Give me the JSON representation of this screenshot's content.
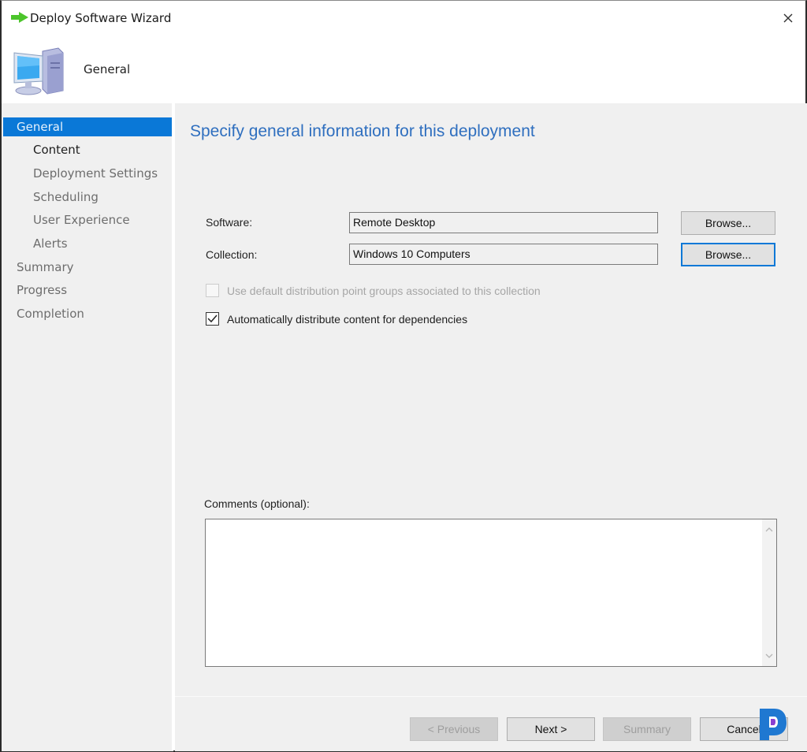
{
  "window": {
    "title": "Deploy Software Wizard",
    "close_icon": "close-icon",
    "title_icon": "green-arrow-icon"
  },
  "header": {
    "title": "General",
    "icon": "computer-icon"
  },
  "sidebar": {
    "items": [
      {
        "label": "General",
        "level": "top",
        "state": "active"
      },
      {
        "label": "Content",
        "level": "sub",
        "state": "current"
      },
      {
        "label": "Deployment Settings",
        "level": "sub",
        "state": "pending"
      },
      {
        "label": "Scheduling",
        "level": "sub",
        "state": "pending"
      },
      {
        "label": "User Experience",
        "level": "sub",
        "state": "pending"
      },
      {
        "label": "Alerts",
        "level": "sub",
        "state": "pending"
      },
      {
        "label": "Summary",
        "level": "top",
        "state": "pending"
      },
      {
        "label": "Progress",
        "level": "top",
        "state": "pending"
      },
      {
        "label": "Completion",
        "level": "top",
        "state": "pending"
      }
    ]
  },
  "main": {
    "heading": "Specify general information for this deployment",
    "software": {
      "label": "Software:",
      "value": "Remote Desktop",
      "browse_label": "Browse..."
    },
    "collection": {
      "label": "Collection:",
      "value": "Windows 10 Computers",
      "browse_label": "Browse..."
    },
    "checkboxes": [
      {
        "label": "Use default distribution point groups associated to this collection",
        "checked": false,
        "enabled": false
      },
      {
        "label": "Automatically distribute content for dependencies",
        "checked": true,
        "enabled": true
      }
    ],
    "comments": {
      "label": "Comments (optional):",
      "value": ""
    }
  },
  "footer": {
    "previous_label": "< Previous",
    "next_label": "Next >",
    "summary_label": "Summary",
    "cancel_label": "Cancel"
  },
  "colors": {
    "accent": "#0a78d7",
    "heading": "#2f6fbf",
    "panel": "#f0f0f0"
  }
}
